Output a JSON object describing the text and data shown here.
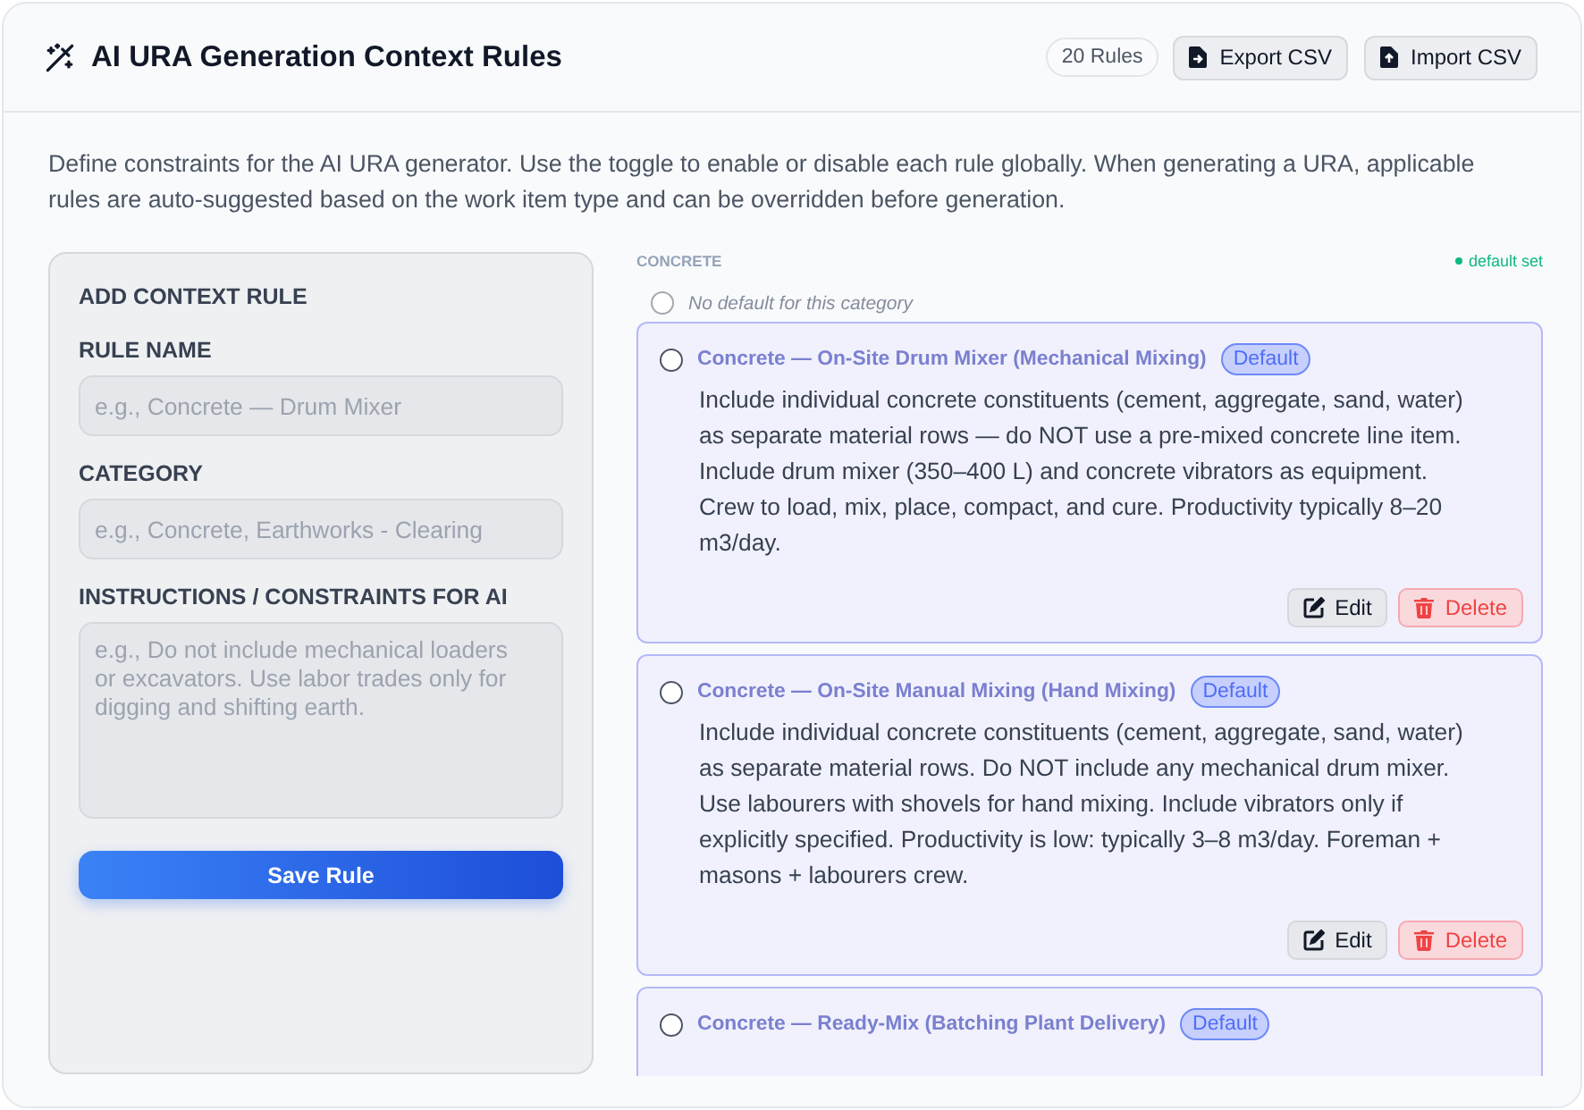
{
  "header": {
    "title": "AI URA Generation Context Rules",
    "rule_count": "20 Rules",
    "buttons": [
      {
        "label": "Export CSV",
        "kind": "export"
      },
      {
        "label": "Import CSV",
        "kind": "import"
      }
    ]
  },
  "description": "Define constraints for the AI URA generator. Use the toggle to enable or disable each rule globally. When generating a URA, applicable rules are auto-suggested based on the work item type and can be overridden before generation.",
  "form": {
    "title": "ADD CONTEXT RULE",
    "fields": [
      {
        "label": "RULE NAME",
        "placeholder": "e.g., Concrete — Drum Mixer",
        "kind": "input"
      },
      {
        "label": "CATEGORY",
        "placeholder": "e.g., Concrete, Earthworks - Clearing",
        "kind": "input"
      },
      {
        "label": "INSTRUCTIONS / CONSTRAINTS FOR AI",
        "placeholder": "e.g., Do not include mechanical loaders or excavators. Use labor trades only for digging and shifting earth.",
        "kind": "textarea"
      }
    ],
    "submit": "Save Rule"
  },
  "rules": {
    "category": "CONCRETE",
    "status": "default set",
    "none_option": {
      "label": "No default for this category",
      "selected": false
    },
    "items": [
      {
        "title": "Concrete — On-Site Drum Mixer (Mechanical Mixing)",
        "badge": "Default",
        "selected": false,
        "description": "Include individual concrete constituents (cement, aggregate, sand, water) as separate material rows — do NOT use a pre-mixed concrete line item. Include drum mixer (350–400 L) and concrete vibrators as equipment. Crew to load, mix, place, compact, and cure. Productivity typically 8–20 m3/day.",
        "actions": [
          {
            "label": "Edit",
            "kind": "edit"
          },
          {
            "label": "Delete",
            "kind": "delete"
          }
        ]
      },
      {
        "title": "Concrete — On-Site Manual Mixing (Hand Mixing)",
        "badge": "Default",
        "selected": false,
        "description": "Include individual concrete constituents (cement, aggregate, sand, water) as separate material rows. Do NOT include any mechanical drum mixer. Use labourers with shovels for hand mixing. Include vibrators only if explicitly specified. Productivity is low: typically 3–8 m3/day. Foreman + masons + labourers crew.",
        "actions": [
          {
            "label": "Edit",
            "kind": "edit"
          },
          {
            "label": "Delete",
            "kind": "delete"
          }
        ]
      },
      {
        "title": "Concrete — Ready-Mix (Batching Plant Delivery)",
        "badge": "Default",
        "selected": false
      }
    ]
  }
}
